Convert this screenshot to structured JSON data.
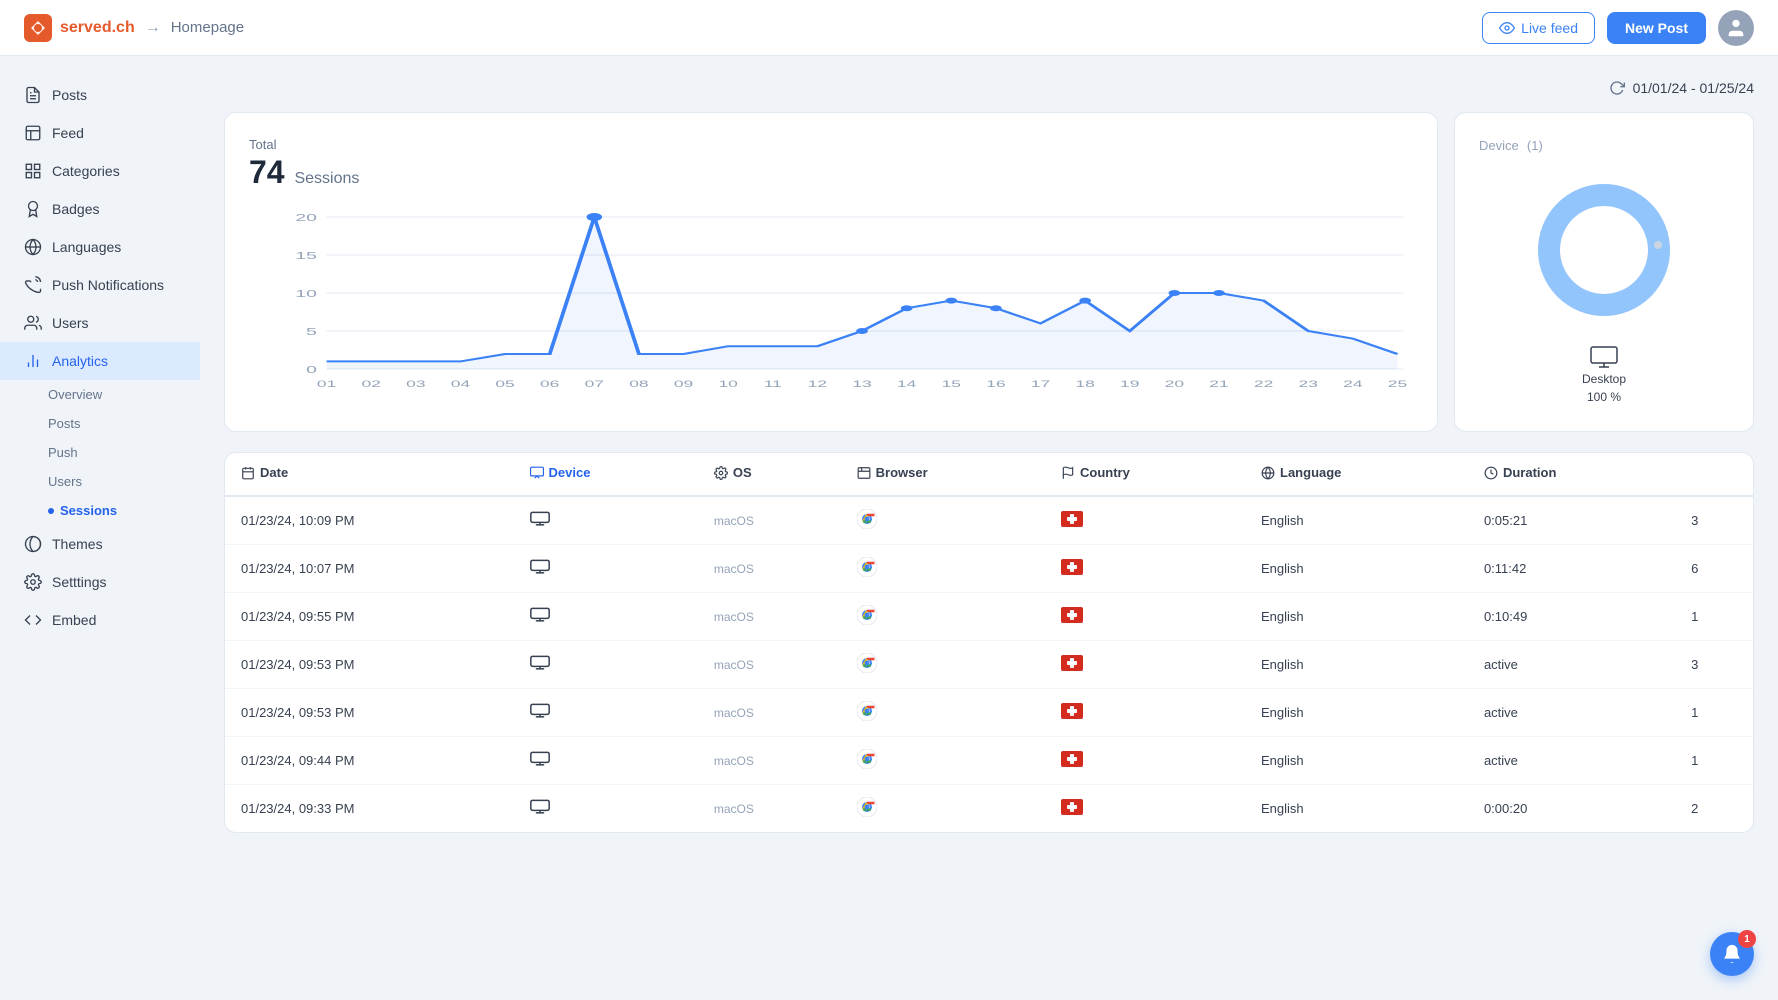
{
  "topnav": {
    "logo_text": "served.ch",
    "breadcrumb_arrow": "→",
    "breadcrumb_text": "Homepage",
    "live_feed_label": "Live feed",
    "new_post_label": "New Post"
  },
  "sidebar": {
    "items": [
      {
        "id": "posts",
        "label": "Posts",
        "icon": "posts-icon"
      },
      {
        "id": "feed",
        "label": "Feed",
        "icon": "feed-icon"
      },
      {
        "id": "categories",
        "label": "Categories",
        "icon": "categories-icon"
      },
      {
        "id": "badges",
        "label": "Badges",
        "icon": "badges-icon"
      },
      {
        "id": "languages",
        "label": "Languages",
        "icon": "languages-icon"
      },
      {
        "id": "push-notifications",
        "label": "Push Notifications",
        "icon": "push-icon"
      },
      {
        "id": "users",
        "label": "Users",
        "icon": "users-icon"
      },
      {
        "id": "analytics",
        "label": "Analytics",
        "icon": "analytics-icon",
        "active": true
      },
      {
        "id": "themes",
        "label": "Themes",
        "icon": "themes-icon"
      },
      {
        "id": "settings",
        "label": "Setttings",
        "icon": "settings-icon"
      },
      {
        "id": "embed",
        "label": "Embed",
        "icon": "embed-icon"
      }
    ],
    "analytics_sub": [
      {
        "id": "overview",
        "label": "Overview"
      },
      {
        "id": "posts",
        "label": "Posts"
      },
      {
        "id": "push",
        "label": "Push"
      },
      {
        "id": "users",
        "label": "Users"
      },
      {
        "id": "sessions",
        "label": "Sessions",
        "active": true
      }
    ]
  },
  "date_range": {
    "label": "01/01/24 - 01/25/24"
  },
  "chart": {
    "total_label": "Total",
    "total_value": "74",
    "sessions_label": "Sessions",
    "x_labels": [
      "01",
      "02",
      "03",
      "04",
      "05",
      "06",
      "07",
      "08",
      "09",
      "10",
      "11",
      "12",
      "13",
      "14",
      "15",
      "16",
      "17",
      "18",
      "19",
      "20",
      "21",
      "22",
      "23",
      "24",
      "25"
    ],
    "y_labels": [
      "0",
      "5",
      "10",
      "15",
      "20"
    ],
    "data_points": [
      1,
      1,
      1,
      1,
      2,
      2,
      20,
      2,
      2,
      3,
      3,
      3,
      5,
      8,
      9,
      8,
      6,
      9,
      5,
      10,
      10,
      9,
      5,
      4,
      2
    ]
  },
  "device_card": {
    "title": "Device",
    "count": "(1)",
    "desktop_label": "Desktop",
    "desktop_pct": "100 %"
  },
  "table": {
    "columns": [
      {
        "id": "date",
        "label": "Date",
        "icon": "calendar-icon",
        "active": false
      },
      {
        "id": "device",
        "label": "Device",
        "icon": "device-icon",
        "active": true
      },
      {
        "id": "os",
        "label": "OS",
        "icon": "gear-icon",
        "active": false
      },
      {
        "id": "browser",
        "label": "Browser",
        "icon": "browser-icon",
        "active": false
      },
      {
        "id": "country",
        "label": "Country",
        "icon": "flag-icon",
        "active": false
      },
      {
        "id": "language",
        "label": "Language",
        "icon": "globe-icon",
        "active": false
      },
      {
        "id": "duration",
        "label": "Duration",
        "icon": "clock-icon",
        "active": false
      },
      {
        "id": "count",
        "label": "",
        "icon": "",
        "active": false
      }
    ],
    "rows": [
      {
        "date": "01/23/24, 10:09 PM",
        "os": "macOS",
        "language": "English",
        "duration": "0:05:21",
        "count": "3"
      },
      {
        "date": "01/23/24, 10:07 PM",
        "os": "macOS",
        "language": "English",
        "duration": "0:11:42",
        "count": "6"
      },
      {
        "date": "01/23/24, 09:55 PM",
        "os": "macOS",
        "language": "English",
        "duration": "0:10:49",
        "count": "1"
      },
      {
        "date": "01/23/24, 09:53 PM",
        "os": "macOS",
        "language": "English",
        "duration": "active",
        "count": "3"
      },
      {
        "date": "01/23/24, 09:53 PM",
        "os": "macOS",
        "language": "English",
        "duration": "active",
        "count": "1"
      },
      {
        "date": "01/23/24, 09:44 PM",
        "os": "macOS",
        "language": "English",
        "duration": "active",
        "count": "1"
      },
      {
        "date": "01/23/24, 09:33 PM",
        "os": "macOS",
        "language": "English",
        "duration": "0:00:20",
        "count": "2"
      }
    ]
  },
  "notification": {
    "count": "1"
  }
}
